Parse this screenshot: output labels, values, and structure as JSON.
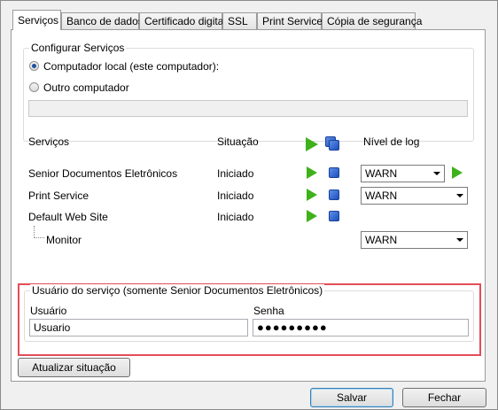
{
  "tabs": [
    {
      "label": "Serviços",
      "active": true
    },
    {
      "label": "Banco de dados",
      "active": false
    },
    {
      "label": "Certificado digital",
      "active": false
    },
    {
      "label": "SSL",
      "active": false
    },
    {
      "label": "Print Service",
      "active": false
    },
    {
      "label": "Cópia de segurança",
      "active": false
    }
  ],
  "config": {
    "title": "Configurar Serviços",
    "options": [
      {
        "label": "Computador local (este computador):",
        "selected": true
      },
      {
        "label": "Outro computador",
        "selected": false
      }
    ],
    "computer_value": ""
  },
  "services": {
    "headers": {
      "name": "Serviços",
      "status": "Situação",
      "log": "Nível de log"
    },
    "rows": [
      {
        "name": "Senior Documentos Eletrônicos",
        "status": "Iniciado",
        "log": "WARN"
      },
      {
        "name": "Print Service",
        "status": "Iniciado",
        "log": "WARN"
      },
      {
        "name": "Default Web Site",
        "status": "Iniciado",
        "log": ""
      },
      {
        "name": "Monitor",
        "status": "",
        "log": "WARN"
      }
    ]
  },
  "user": {
    "title": "Usuário do serviço (somente Senior Documentos Eletrônicos)",
    "user_label": "Usuário",
    "user_value": "Usuario",
    "password_label": "Senha",
    "password_value": "●●●●●●●●●"
  },
  "buttons": {
    "refresh": "Atualizar situação",
    "save": "Salvar",
    "close": "Fechar"
  },
  "colors": {
    "highlight": "#e34d57",
    "play": "#3fb21b",
    "stop": "#1d4fc0"
  }
}
